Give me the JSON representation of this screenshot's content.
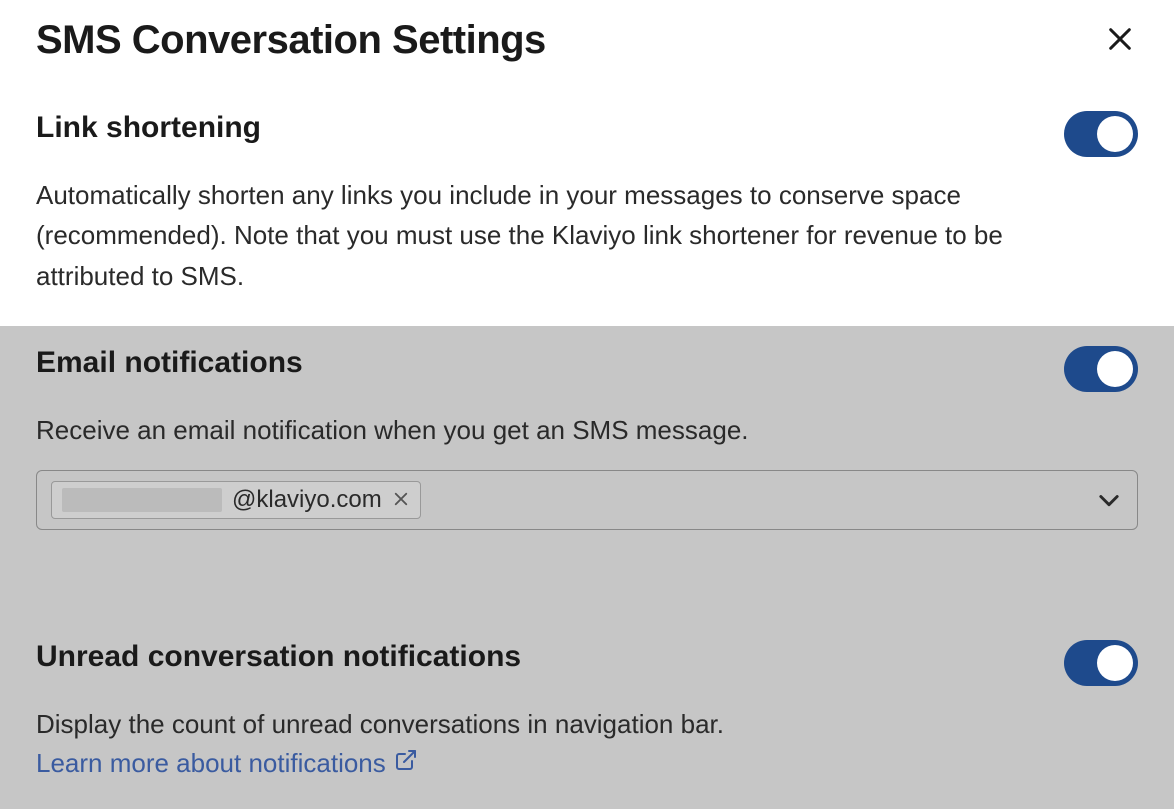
{
  "modal": {
    "title": "SMS Conversation Settings"
  },
  "sections": {
    "link_shortening": {
      "title": "Link shortening",
      "desc": "Automatically shorten any links you include in your messages to conserve space (recommended). Note that you must use the Klaviyo link shortener for revenue to be attributed to SMS.",
      "toggle_on": true
    },
    "email_notifications": {
      "title": "Email notifications",
      "desc": "Receive an email notification when you get an SMS message.",
      "toggle_on": true,
      "email_domain": "@klaviyo.com"
    },
    "unread_notifications": {
      "title": "Unread conversation notifications",
      "desc": "Display the count of unread conversations in navigation bar.",
      "learn_more_label": "Learn more about notifications",
      "toggle_on": true
    }
  }
}
